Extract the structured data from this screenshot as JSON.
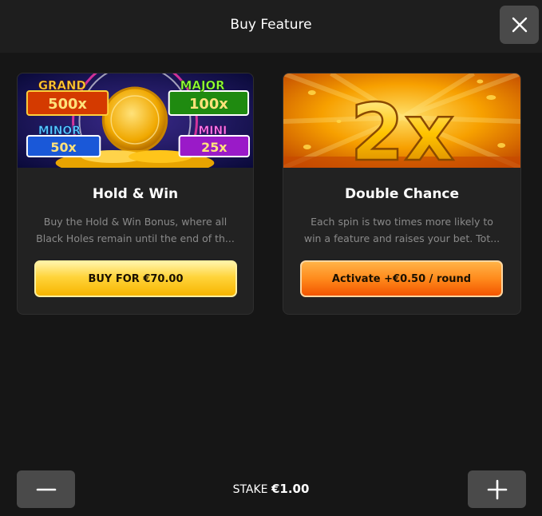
{
  "header": {
    "title": "Buy Feature"
  },
  "cards": [
    {
      "title": "Hold & Win",
      "description_lines": [
        "Buy the Hold & Win Bonus, where all",
        "Black Holes remain until the end of th..."
      ],
      "button_label": "BUY FOR €70.00",
      "jackpots": [
        {
          "label": "GRAND",
          "value": "500x"
        },
        {
          "label": "MAJOR",
          "value": "100x"
        },
        {
          "label": "MINOR",
          "value": "50x"
        },
        {
          "label": "MINI",
          "value": "25x"
        }
      ]
    },
    {
      "title": "Double Chance",
      "description_lines": [
        "Each spin is two times more likely to",
        "win a feature and raises your bet. Tot..."
      ],
      "button_label": "Activate +€0.50 / round",
      "image_text": "2x"
    }
  ],
  "footer": {
    "stake_label": "STAKE",
    "stake_value": "€1.00"
  },
  "colors": {
    "background": "#161616",
    "card": "#222222",
    "button_grey": "#4a4a4a",
    "buy_yellow": "#ffd43a",
    "activate_orange": "#ff8a1c"
  }
}
